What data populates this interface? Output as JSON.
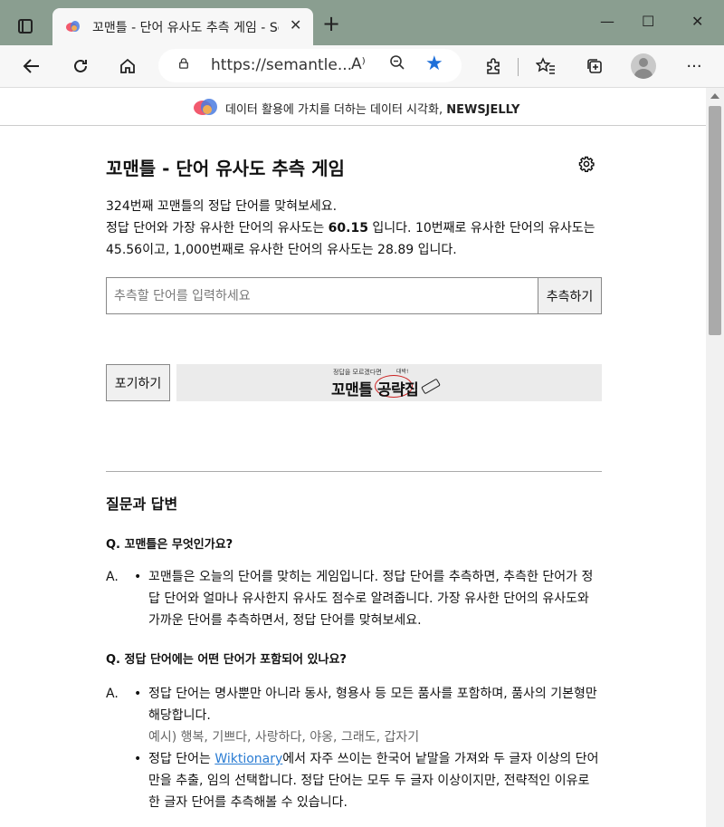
{
  "browser": {
    "tab_title": "꼬맨틀 - 단어 유사도 추측 게임 - Semantle 한국어 버전",
    "url": "https://semantle...",
    "new_tab": "+",
    "tab_close": "✕",
    "window_minimize": "—",
    "window_maximize": "☐",
    "window_close": "✕",
    "read_aloud": "A⁾",
    "more": "···"
  },
  "banner": {
    "text": "데이터 활용에 가치를 더하는 데이터 시각화, ",
    "brand": "NEWSJELLY"
  },
  "game": {
    "title": "꼬맨틀 - 단어 유사도 추측 게임",
    "intro_line1": "324번째 꼬맨틀의 정답 단어를 맞혀보세요.",
    "intro_line2_a": "정답 단어와 가장 유사한 단어의 유사도는 ",
    "top_similarity": "60.15",
    "intro_line2_b": " 입니다. 10번째로 유사한 단어의 유사도는 45.56이고, 1,000번째로 유사한 단어의 유사도는 28.89 입니다.",
    "input_placeholder": "추측할 단어를 입력하세요",
    "guess_button": "추측하기",
    "giveup_button": "포기하기",
    "guide_small": "정답을 모르겠다면",
    "guide_main": "꼬맨틀 공략집",
    "guide_badge": "대박!"
  },
  "qa": {
    "title": "질문과 답변",
    "q1": "Q. 꼬맨틀은 무엇인가요?",
    "a_label": "A.",
    "a1_item1": "꼬맨틀은 오늘의 단어를 맞히는 게임입니다. 정답 단어를 추측하면, 추측한 단어가 정답 단어와 얼마나 유사한지 유사도 점수로 알려줍니다. 가장 유사한 단어의 유사도와 가까운 단어를 추측하면서, 정답 단어를 맞혀보세요.",
    "q2": "Q. 정답 단어에는 어떤 단어가 포함되어 있나요?",
    "a2_item1": "정답 단어는 명사뿐만 아니라 동사, 형용사 등 모든 품사를 포함하며, 품사의 기본형만 해당합니다.",
    "a2_item1_example": "예시) 행복, 기쁘다, 사랑하다, 야옹, 그래도, 갑자기",
    "a2_item2_a": "정답 단어는 ",
    "a2_item2_link": "Wiktionary",
    "a2_item2_b": "에서 자주 쓰이는 한국어 낱말을 가져와 두 글자 이상의 단어만을 추출, 임의 선택합니다. 정답 단어는 모두 두 글자 이상이지만, 전략적인 이유로 한 글자 단어를 추측해볼 수 있습니다."
  }
}
